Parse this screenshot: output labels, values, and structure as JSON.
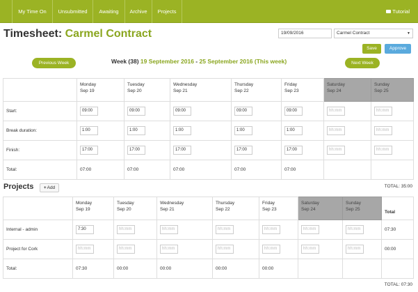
{
  "nav": {
    "items": [
      "My Time On",
      "Unsubmitted",
      "Awaiting",
      "Archive",
      "Projects"
    ],
    "tutorial_label": "Tutorial"
  },
  "header": {
    "title_prefix": "Timesheet: ",
    "contract_name": "Carmel Contract",
    "date_value": "19/09/2016",
    "contract_select": "Carmel Contract"
  },
  "actions": {
    "save": "Save",
    "approve": "Approve"
  },
  "week": {
    "prev": "Previous Week",
    "next": "Next Week",
    "label": "Week (38)",
    "start": "19 September 2016",
    "sep": " - ",
    "end": "25 September 2016 (This week)"
  },
  "days": [
    {
      "name": "Monday",
      "date": "Sep 19"
    },
    {
      "name": "Tuesday",
      "date": "Sep 20"
    },
    {
      "name": "Wednesday",
      "date": "Sep 21"
    },
    {
      "name": "Thursday",
      "date": "Sep 22"
    },
    {
      "name": "Friday",
      "date": "Sep 23"
    },
    {
      "name": "Saturday",
      "date": "Sep 24"
    },
    {
      "name": "Sunday",
      "date": "Sep 25"
    }
  ],
  "timesheet": {
    "start_label": "Start:",
    "break_label": "Break duration:",
    "finish_label": "Finish:",
    "total_label": "Total:",
    "start": [
      "09:00",
      "09:00",
      "09:00",
      "09:00",
      "09:00",
      "",
      ""
    ],
    "break": [
      "1:00",
      "1:00",
      "1:00",
      "1:00",
      "1:00",
      "",
      ""
    ],
    "finish": [
      "17:00",
      "17:00",
      "17:00",
      "17:00",
      "17:00",
      "",
      ""
    ],
    "totals": [
      "07:00",
      "07:00",
      "07:00",
      "07:00",
      "07:00",
      "",
      ""
    ],
    "placeholder": "hh:mm"
  },
  "projects": {
    "title": "Projects",
    "add_label": "Add",
    "total_top": "TOTAL: 35:00",
    "total_col": "Total",
    "rows": [
      {
        "name": "Internal - admin",
        "values": [
          "7:30",
          "",
          "",
          "",
          "",
          "",
          ""
        ],
        "total": "07:30"
      },
      {
        "name": "Project for Cork",
        "values": [
          "",
          "",
          "",
          "",
          "",
          "",
          ""
        ],
        "total": "00:00"
      }
    ],
    "total_label": "Total:",
    "totals": [
      "07:30",
      "00:00",
      "00:00",
      "00:00",
      "00:00",
      "",
      ""
    ],
    "total_bottom": "TOTAL: 07:30"
  }
}
